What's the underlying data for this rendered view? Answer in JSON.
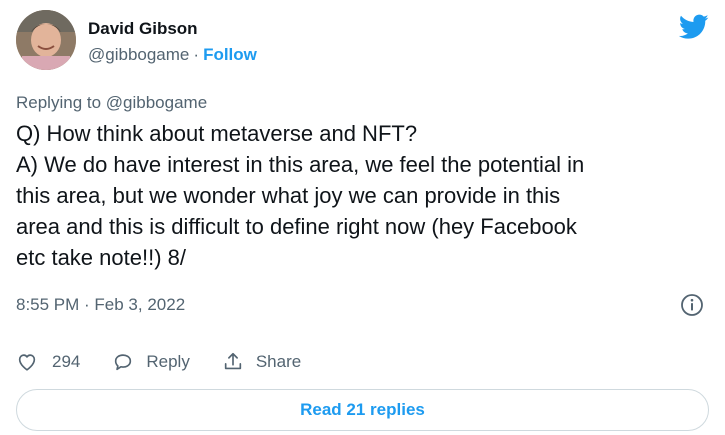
{
  "author": {
    "display_name": "David Gibson",
    "handle": "@gibbogame",
    "separator": "·",
    "follow_label": "Follow"
  },
  "replying_to": "Replying to @gibbogame",
  "tweet_text": "Q) How think about metaverse and NFT?\nA) We do have interest in this area, we feel the potential in\nthis area, but we wonder what joy we can provide in this\narea and this is difficult to define right now (hey Facebook\netc take note!!) 8/",
  "timestamp": "8:55 PM · Feb 3, 2022",
  "actions": {
    "like_count": "294",
    "reply_label": "Reply",
    "share_label": "Share"
  },
  "read_replies_label": "Read 21 replies",
  "colors": {
    "accent": "#1d9bf0",
    "muted": "#536471",
    "border": "#cfd9de"
  },
  "icons": {
    "brand": "twitter-bird-icon",
    "info": "info-icon",
    "like": "heart-icon",
    "reply": "reply-bubble-icon",
    "share": "share-upload-icon"
  }
}
